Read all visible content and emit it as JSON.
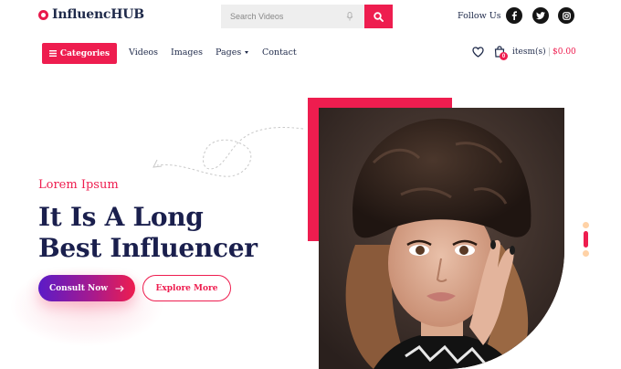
{
  "brand": {
    "name": "InfluencHUB"
  },
  "search": {
    "placeholder": "Search Videos"
  },
  "social": {
    "follow_label": "Follow Us",
    "networks": [
      "facebook",
      "twitter",
      "instagram"
    ]
  },
  "nav": {
    "categories_label": "Categories",
    "links": [
      "Videos",
      "Images",
      "Pages",
      "Contact"
    ]
  },
  "cart": {
    "count": "0",
    "items_label": "itesm(s)",
    "separator": "|",
    "price": "$0.00"
  },
  "hero": {
    "kicker": "Lorem Ipsum",
    "headline_line1": "It Is A Long",
    "headline_line2": "Best Influencer",
    "consult_label": "Consult Now",
    "explore_label": "Explore More"
  },
  "colors": {
    "accent": "#ee1d4f",
    "navy": "#1a1f4d",
    "gradient_start": "#5b1bc7"
  }
}
